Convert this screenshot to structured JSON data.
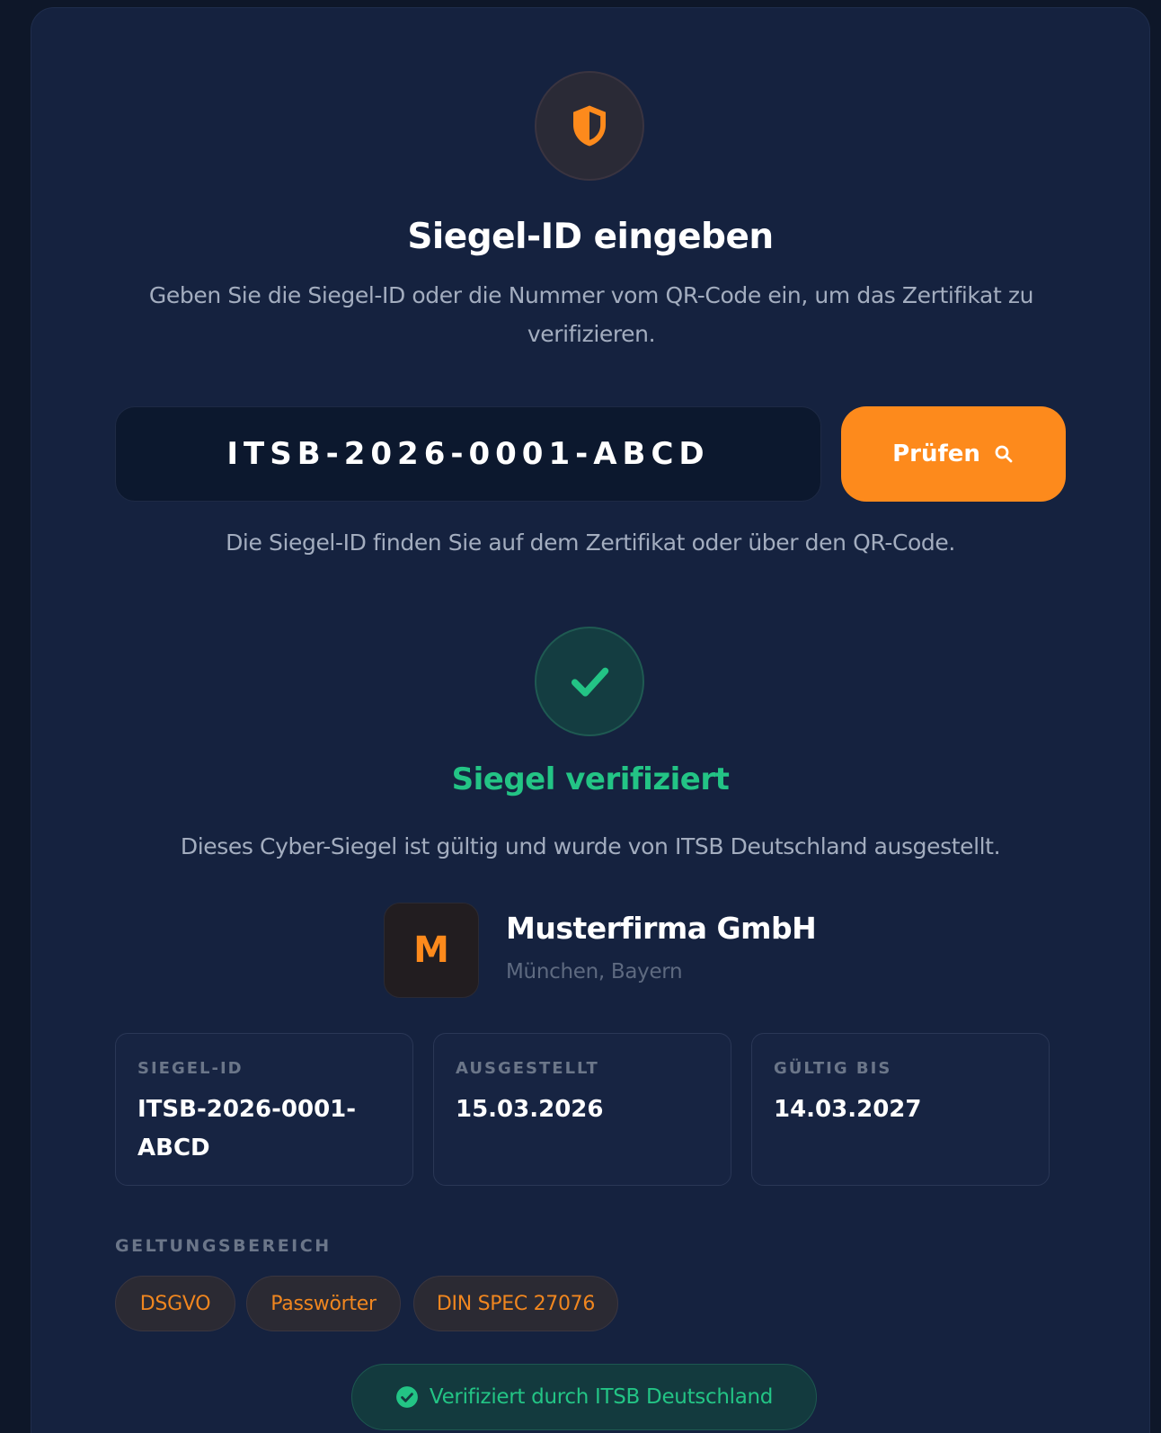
{
  "header": {
    "icon": "shield-icon",
    "title": "Siegel-ID eingeben",
    "subtitle": "Geben Sie die Siegel-ID oder die Nummer vom QR-Code ein, um das Zertifikat zu verifizieren."
  },
  "search": {
    "value": "ITSB-2026-0001-ABCD",
    "button_label": "Prüfen",
    "button_icon": "search-icon",
    "hint": "Die Siegel-ID finden Sie auf dem Zertifikat oder über den QR-Code."
  },
  "result": {
    "icon": "check-icon",
    "title": "Siegel verifiziert",
    "description": "Dieses Cyber-Siegel ist gültig und wurde von ITSB Deutschland ausgestellt."
  },
  "company": {
    "logo_letter": "M",
    "name": "Musterfirma GmbH",
    "location": "München, Bayern"
  },
  "details": [
    {
      "label": "SIEGEL-ID",
      "value": "ITSB-2026-0001-ABCD"
    },
    {
      "label": "AUSGESTELLT",
      "value": "15.03.2026"
    },
    {
      "label": "GÜLTIG BIS",
      "value": "14.03.2027"
    }
  ],
  "scope": {
    "label": "GELTUNGSBEREICH",
    "tags": [
      "DSGVO",
      "Passwörter",
      "DIN SPEC 27076"
    ]
  },
  "footer": {
    "icon": "check-circle-icon",
    "label": "Verifiziert durch ITSB Deutschland"
  },
  "colors": {
    "background": "#0e1729",
    "card": "#15223f",
    "accent": "#fd8a1c",
    "success": "#23c485"
  }
}
